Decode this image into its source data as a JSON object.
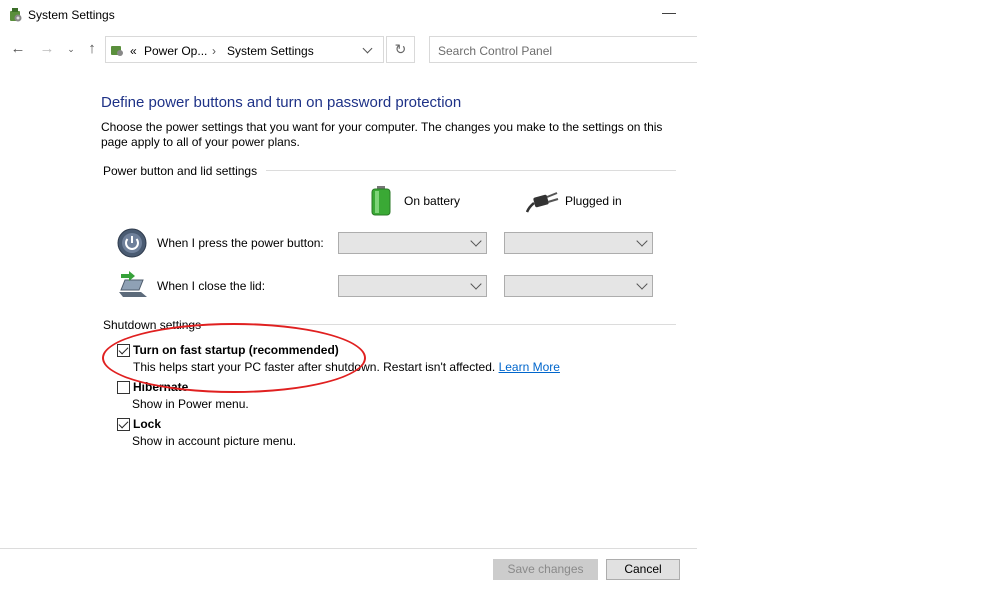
{
  "window": {
    "title": "System Settings",
    "minimize_glyph": "—"
  },
  "toolbar": {
    "breadcrumb_prefix": "«",
    "breadcrumb": [
      "Power Op...",
      "System Settings"
    ],
    "breadcrumb_separator": "›",
    "search_placeholder": "Search Control Panel"
  },
  "main": {
    "heading": "Define power buttons and turn on password protection",
    "description": "Choose the power settings that you want for your computer. The changes you make to the settings on this page apply to all of your power plans.",
    "power_group": {
      "label": "Power button and lid settings",
      "columns": [
        "On battery",
        "Plugged in"
      ],
      "rows": [
        {
          "label": "When I press the power button:",
          "on_battery": "",
          "plugged_in": ""
        },
        {
          "label": "When I close the lid:",
          "on_battery": "",
          "plugged_in": ""
        }
      ]
    },
    "shutdown_group": {
      "label": "Shutdown settings",
      "options": [
        {
          "title": "Turn on fast startup (recommended)",
          "checked": true,
          "description": "This helps start your PC faster after shutdown. Restart isn't affected.",
          "link": "Learn More"
        },
        {
          "title": "Hibernate",
          "checked": false,
          "description": "Show in Power menu."
        },
        {
          "title": "Lock",
          "checked": true,
          "description": "Show in account picture menu."
        }
      ]
    }
  },
  "footer": {
    "save_label": "Save changes",
    "cancel_label": "Cancel"
  },
  "colors": {
    "heading": "#1e3287",
    "link": "#0066cc",
    "annotation": "#e02020"
  }
}
